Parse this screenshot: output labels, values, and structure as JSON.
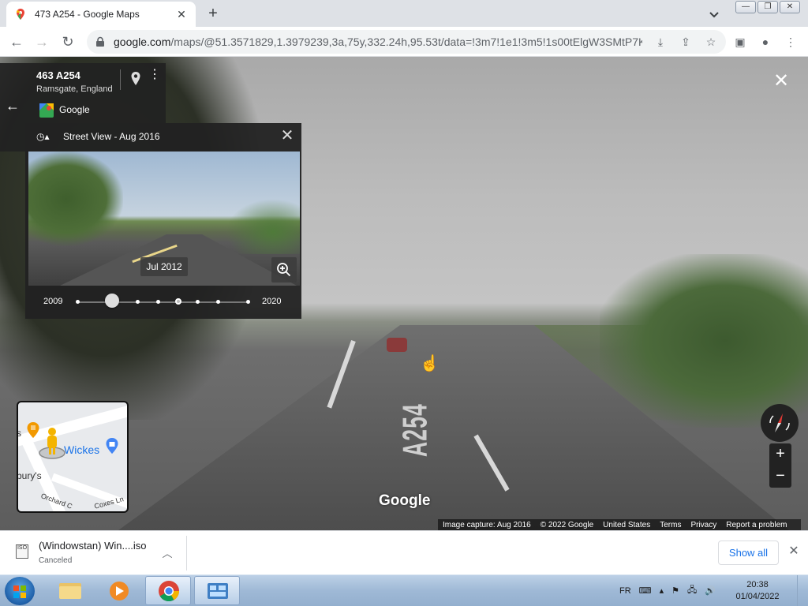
{
  "browser": {
    "tab_title": "473 A254 - Google Maps",
    "url_main": "google.com",
    "url_rest": "/maps/@51.3571829,1.3979239,3a,75y,332.24h,95.53t/data=!3m7!1e1!3m5!1s00tElgW3SMtP7K..."
  },
  "place": {
    "title": "463 A254",
    "subtitle": "Ramsgate, England",
    "contributor": "Google"
  },
  "time_machine": {
    "header": "Street View - Aug 2016",
    "thumb_date": "Jul 2012",
    "year_start": "2009",
    "year_end": "2020",
    "selected_position": 0.2
  },
  "minimap": {
    "poi_label": "Wickes",
    "left_label": "s",
    "bottom_left_label": "bury's",
    "road1": "Orchard C",
    "road2": "Coxes Ln"
  },
  "streetview": {
    "watermark": "Google",
    "road_marking": "A254",
    "footer": [
      "Image capture: Aug 2016",
      "© 2022 Google",
      "United States",
      "Terms",
      "Privacy",
      "Report a problem"
    ]
  },
  "download": {
    "filename": "(Windowstan) Win....iso",
    "status": "Canceled",
    "show_all": "Show all",
    "icon_text": "ISO"
  },
  "taskbar": {
    "lang": "FR",
    "time": "20:38",
    "date": "01/04/2022"
  }
}
